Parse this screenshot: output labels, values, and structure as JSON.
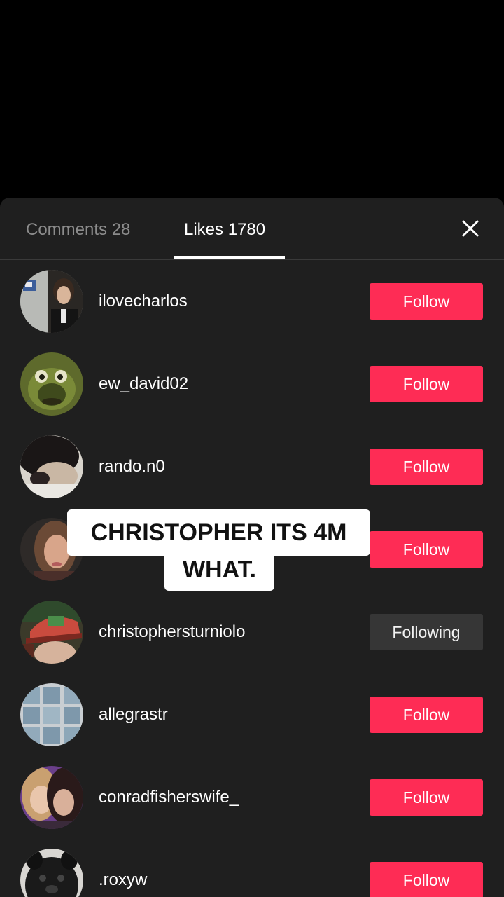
{
  "tabs": {
    "comments_label": "Comments 28",
    "likes_label": "Likes 1780",
    "close_icon": "close-icon"
  },
  "likes": [
    {
      "username": "ilovecharlos",
      "button": "Follow",
      "state": "follow"
    },
    {
      "username": "ew_david02",
      "button": "Follow",
      "state": "follow"
    },
    {
      "username": "rando.n0",
      "button": "Follow",
      "state": "follow"
    },
    {
      "username": "",
      "button": "Follow",
      "state": "follow"
    },
    {
      "username": "christophersturniolo",
      "button": "Following",
      "state": "following"
    },
    {
      "username": "allegrastr",
      "button": "Follow",
      "state": "follow"
    },
    {
      "username": "conradfisherswife_",
      "button": "Follow",
      "state": "follow"
    },
    {
      "username": ".roxyw",
      "button": "Follow",
      "state": "follow"
    }
  ],
  "caption": {
    "line1": "CHRISTOPHER ITS 4M",
    "line2": "WHAT."
  },
  "colors": {
    "follow_button": "#fe2c55",
    "following_button": "#363636",
    "sheet_background": "#1f1f1f"
  }
}
